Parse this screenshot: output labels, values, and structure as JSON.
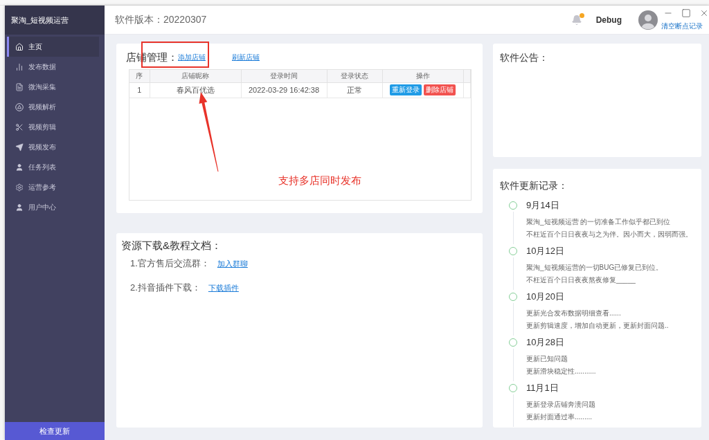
{
  "sidebar": {
    "title": "聚淘_短视频运营",
    "items": [
      {
        "label": "主页",
        "selected": true
      },
      {
        "label": "发布数据",
        "selected": false
      },
      {
        "label": "微淘采集",
        "selected": false
      },
      {
        "label": "视频解析",
        "selected": false
      },
      {
        "label": "视频剪辑",
        "selected": false
      },
      {
        "label": "视频发布",
        "selected": false
      },
      {
        "label": "任务列表",
        "selected": false
      },
      {
        "label": "运营参考",
        "selected": false
      },
      {
        "label": "用户中心",
        "selected": false
      }
    ],
    "footer_button": "检查更新"
  },
  "header": {
    "version": "软件版本：20220307",
    "notifications_unread": true,
    "user_name": "Debug",
    "link": "清空断点记录"
  },
  "store_panel": {
    "title": "店铺管理：",
    "links": [
      "添加店铺",
      "刷新店铺"
    ],
    "table": {
      "columns": [
        "序",
        "店铺昵称",
        "登录时间",
        "登录状态",
        "操作"
      ],
      "rows": [
        {
          "index": "1",
          "name": "春风百优选",
          "login_time": "2022-03-29 16:42:38",
          "status": "正常",
          "actions": [
            {
              "label": "重新登录",
              "kind": "primary"
            },
            {
              "label": "删除店铺",
              "kind": "danger"
            }
          ]
        }
      ]
    }
  },
  "annotation": {
    "text": "支持多店同时发布"
  },
  "resources_panel": {
    "title": "资源下载&教程文档：",
    "items": [
      {
        "label": "1.官方售后交流群：",
        "link": "加入群聊"
      },
      {
        "label": "2.抖音插件下载：",
        "link": "下载插件"
      }
    ]
  },
  "announcement_panel": {
    "title": "软件公告："
  },
  "update_log": {
    "title": "软件更新记录：",
    "entries": [
      {
        "date": "9月14日",
        "lines": [
          "聚淘_短视频运营 的一切准备工作似乎都已到位",
          "不枉近百个日日夜夜与之为伴。因小而大，因弱而强。"
        ]
      },
      {
        "date": "10月12日",
        "lines": [
          "聚淘_短视频运营的一切BUG已修复已到位。",
          "不枉近百个日日夜夜熬夜修复_____"
        ]
      },
      {
        "date": "10月20日",
        "lines": [
          "更新光合发布数据明细查看......",
          "更新剪辑速度，增加自动更新，更新封面问题.."
        ]
      },
      {
        "date": "10月28日",
        "lines": [
          "更新已知问题",
          "更新滑块稳定性..........."
        ]
      },
      {
        "date": "11月1日",
        "lines": [
          "更新登录店铺奔溃问题",
          "更新封面通过率........."
        ]
      }
    ]
  }
}
